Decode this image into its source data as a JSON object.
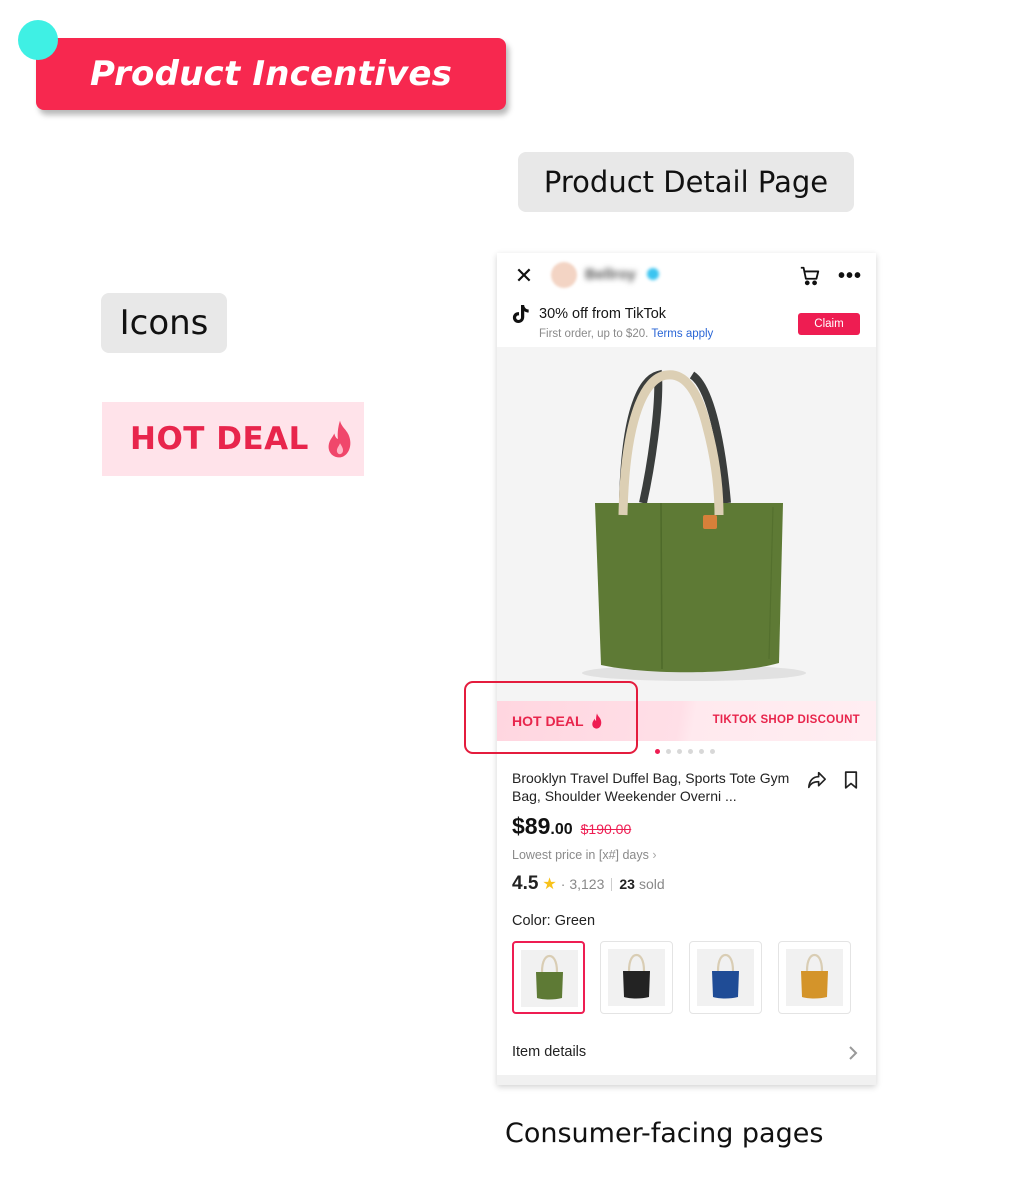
{
  "slide": {
    "title": "Product Incentives",
    "pdp_label": "Product Detail Page",
    "icons_label": "Icons",
    "hot_deal_icon_text": "HOT DEAL",
    "caption": "Consumer-facing pages"
  },
  "phone": {
    "header": {
      "shop_name": "Bellroy"
    },
    "promo": {
      "title": "30% off from TikTok",
      "subtitle": "First order, up to $20.",
      "terms_link": "Terms apply",
      "claim_label": "Claim"
    },
    "deal_strip": {
      "left_label": "HOT DEAL",
      "right_label": "TIKTOK SHOP DISCOUNT"
    },
    "carousel": {
      "count": 6,
      "active_index": 0
    },
    "product": {
      "title": "Brooklyn Travel Duffel Bag, Sports Tote Gym Bag, Shoulder Weekender Overni ...",
      "price_main": "$89",
      "price_cents": ".00",
      "price_original": "$190.00",
      "lowest_price_text": "Lowest price in [x#] days",
      "rating": "4.5",
      "review_count": "· 3,123",
      "sold_count": "23",
      "sold_label": "sold",
      "color_label": "Color: Green",
      "details_label": "Item details"
    },
    "swatches": [
      {
        "name": "Green",
        "color": "#5e7a35",
        "handle": "#d9cdb4",
        "selected": true
      },
      {
        "name": "Black",
        "color": "#232323",
        "handle": "#d9cdb4",
        "selected": false
      },
      {
        "name": "Blue",
        "color": "#1f4c96",
        "handle": "#d9cdb4",
        "selected": false
      },
      {
        "name": "Yellow",
        "color": "#d4942a",
        "handle": "#d9cdb4",
        "selected": false
      }
    ]
  },
  "colors": {
    "banner": "#f7284f",
    "accent_teal": "#3ff0e4",
    "tiktok_red": "#ee1d52",
    "highlight_red": "#e41c3d",
    "hot_deal_bg": "#ffe3ea",
    "bag_green": "#5e7a35"
  }
}
